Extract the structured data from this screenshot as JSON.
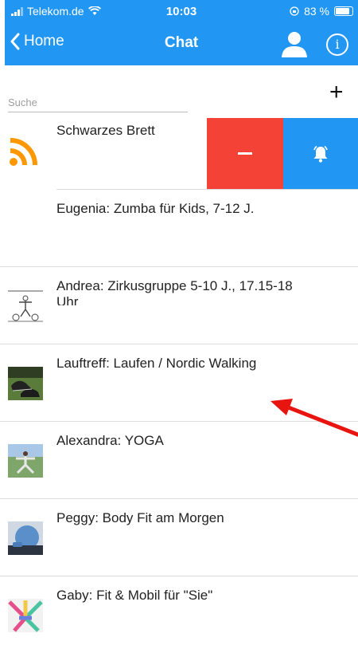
{
  "status_bar": {
    "carrier": "Telekom.de",
    "time": "10:03",
    "battery_label": "83 %"
  },
  "navbar": {
    "back_label": "Home",
    "title": "Chat",
    "info_glyph": "i"
  },
  "search": {
    "placeholder": "Suche",
    "value": ""
  },
  "add_glyph": "+",
  "swipe_actions": {
    "mute_icon": "minus-icon",
    "notify_icon": "bell-icon",
    "mute_color": "#f44336",
    "notify_color": "#2196f3"
  },
  "chats": [
    {
      "title": "Schwarzes Brett",
      "icon": "rss-icon"
    },
    {
      "title": "Eugenia: Zumba für Kids, 7-12 J.",
      "icon": ""
    },
    {
      "title": "Andrea: Zirkusgruppe 5-10 J., 17.15-18 Uhr",
      "icon": "circus-drawing-thumbnail"
    },
    {
      "title": "Lauftreff: Laufen / Nordic Walking",
      "icon": "running-shoes-thumbnail"
    },
    {
      "title": "Alexandra: YOGA",
      "icon": "yoga-thumbnail"
    },
    {
      "title": "Peggy: Body Fit am Morgen",
      "icon": "fitness-ball-thumbnail"
    },
    {
      "title": "Gaby: Fit & Mobil für \"Sie\"",
      "icon": "fitness-bands-thumbnail"
    }
  ],
  "colors": {
    "accent": "#2196f3",
    "danger": "#f44336",
    "rss": "#ff9800",
    "annotation_arrow": "#e8140f"
  }
}
